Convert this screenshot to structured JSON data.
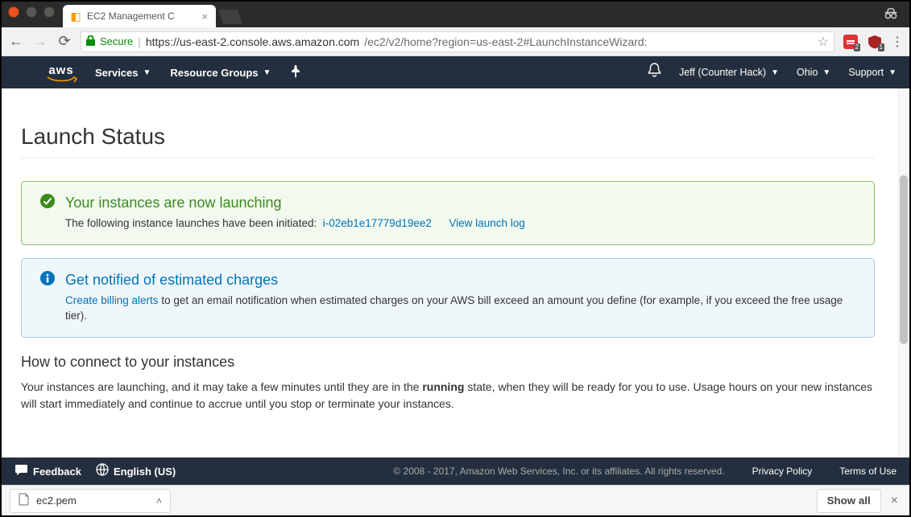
{
  "window": {
    "tab_title": "EC2 Management C"
  },
  "addressbar": {
    "secure_label": "Secure",
    "url_host": "https://us-east-2.console.aws.amazon.com",
    "url_path": "/ec2/v2/home?region=us-east-2#LaunchInstanceWizard:",
    "ext1_badge": "2",
    "ext2_badge": "1"
  },
  "awsnav": {
    "logo_text": "aws",
    "services": "Services",
    "resource_groups": "Resource Groups",
    "account": "Jeff (Counter Hack)",
    "region": "Ohio",
    "support": "Support"
  },
  "page": {
    "title": "Launch Status",
    "success": {
      "heading": "Your instances are now launching",
      "body": "The following instance launches have been initiated:",
      "instance_id": "i-02eb1e17779d19ee2",
      "log_link": "View launch log"
    },
    "info": {
      "heading": "Get notified of estimated charges",
      "link": "Create billing alerts",
      "body_after": " to get an email notification when estimated charges on your AWS bill exceed an amount you define (for example, if you exceed the free usage tier)."
    },
    "connect": {
      "heading": "How to connect to your instances",
      "p1a": "Your instances are launching, and it may take a few minutes until they are in the ",
      "p1b": "running",
      "p1c": " state, when they will be ready for you to use. Usage hours on your new instances will start immediately and continue to accrue until you stop or terminate your instances."
    }
  },
  "footer": {
    "feedback": "Feedback",
    "language": "English (US)",
    "copyright": "© 2008 - 2017, Amazon Web Services, Inc. or its affiliates. All rights reserved.",
    "privacy": "Privacy Policy",
    "terms": "Terms of Use"
  },
  "downloads": {
    "file": "ec2.pem",
    "show_all": "Show all"
  }
}
